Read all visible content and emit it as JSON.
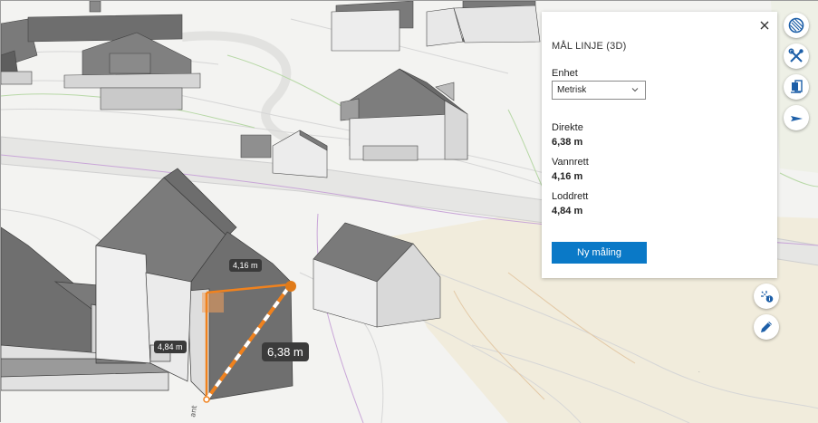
{
  "panel": {
    "title": "MÅL LINJE (3D)",
    "unit_label": "Enhet",
    "unit_value": "Metrisk",
    "direct_label": "Direkte",
    "direct_value": "6,38 m",
    "horizontal_label": "Vannrett",
    "horizontal_value": "4,16 m",
    "vertical_label": "Loddrett",
    "vertical_value": "4,84 m",
    "new_button": "Ny måling"
  },
  "map_labels": {
    "horizontal": "4,16 m",
    "vertical": "4,84 m",
    "direct": "6,38 m"
  },
  "colors": {
    "accent": "#0a79c7",
    "measure_line": "#f0821e",
    "label_bg": "#3a3a3a"
  },
  "icons": {
    "close": "close-icon",
    "layers": "basemap-icon",
    "tools": "tools-icon",
    "legend": "layers-icon",
    "navigate": "navigate-icon",
    "measure": "measure-icon",
    "edit": "edit-icon"
  }
}
